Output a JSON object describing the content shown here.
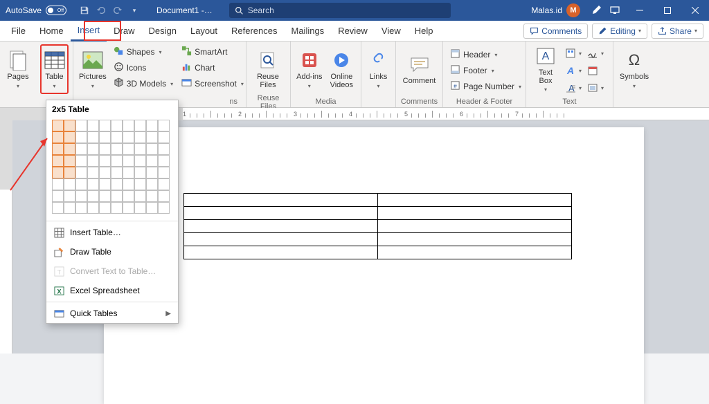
{
  "title": {
    "autosave_label": "AutoSave",
    "autosave_state": "Off",
    "document": "Document1 -…",
    "search_placeholder": "Search",
    "username": "Malas.id",
    "avatar_initial": "M"
  },
  "tabs": {
    "file": "File",
    "home": "Home",
    "insert": "Insert",
    "draw": "Draw",
    "design": "Design",
    "layout": "Layout",
    "references": "References",
    "mailings": "Mailings",
    "review": "Review",
    "view": "View",
    "help": "Help",
    "comments": "Comments",
    "editing": "Editing",
    "share": "Share"
  },
  "ribbon": {
    "pages": "Pages",
    "table": "Table",
    "pictures": "Pictures",
    "shapes": "Shapes",
    "icons": "Icons",
    "models": "3D Models",
    "smartart": "SmartArt",
    "chart": "Chart",
    "screenshot": "Screenshot",
    "reuse_files": "Reuse Files",
    "reuse_files_group": "Reuse Files",
    "addins": "Add-ins",
    "online_videos": "Online Videos",
    "media_group": "Media",
    "links": "Links",
    "comment": "Comment",
    "comments_group": "Comments",
    "header": "Header",
    "footer": "Footer",
    "page_number": "Page Number",
    "hf_group": "Header & Footer",
    "text_box": "Text Box",
    "text_group": "Text",
    "symbols": "Symbols",
    "illustrations_suffix": "ns"
  },
  "dropdown": {
    "title": "2x5 Table",
    "selected_cols": 2,
    "selected_rows": 5,
    "insert_table": "Insert Table…",
    "draw_table": "Draw Table",
    "convert": "Convert Text to Table…",
    "excel": "Excel Spreadsheet",
    "quick": "Quick Tables"
  },
  "ruler": {
    "marks": [
      "1",
      "2",
      "3",
      "4",
      "5",
      "6",
      "7"
    ]
  }
}
